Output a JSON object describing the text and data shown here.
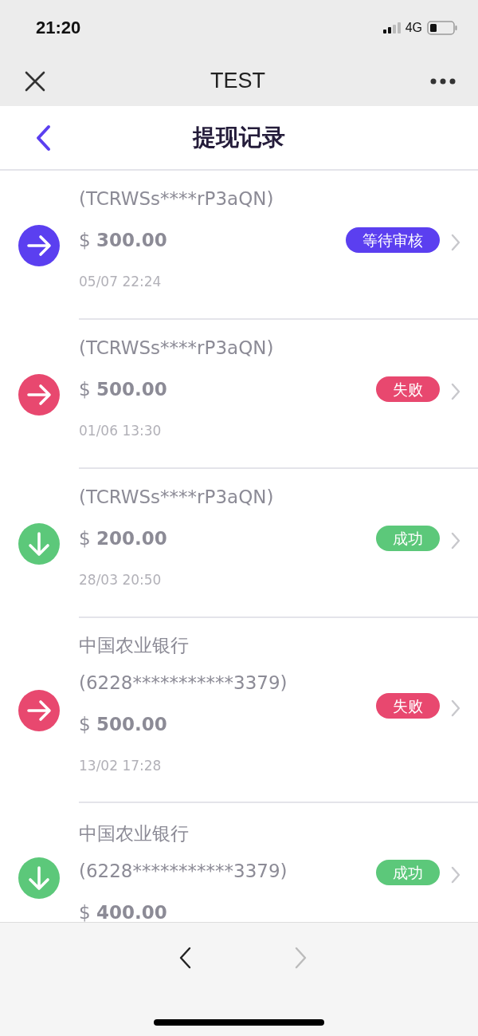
{
  "status_bar": {
    "time": "21:20",
    "network": "4G"
  },
  "browser_bar": {
    "title": "TEST"
  },
  "header": {
    "title": "提现记录"
  },
  "records": [
    {
      "kind": "outgoing",
      "account": "(TCRWSs****rP3aQN)",
      "amount": "$ **300.00**",
      "date": "05/07 22:24",
      "status": {
        "label": "等待审核",
        "color": "#5b3ff0"
      }
    },
    {
      "kind": "outgoing",
      "account": "(TCRWSs****rP3aQN)",
      "amount": "$ **500.00**",
      "date": "01/06 13:30",
      "status": {
        "label": "失败",
        "color": "#e8486f"
      }
    },
    {
      "kind": "incoming",
      "account": "(TCRWSs****rP3aQN)",
      "amount": "$ **200.00**",
      "date": "28/03 20:50",
      "status": {
        "label": "成功",
        "color": "#5cc87a"
      }
    },
    {
      "kind": "outgoing",
      "bank": "中国农业银行",
      "account": "(6228***********3379)",
      "amount": "$ **500.00**",
      "date": "13/02 17:28",
      "status": {
        "label": "失败",
        "color": "#e8486f"
      }
    },
    {
      "kind": "incoming",
      "bank": "中国农业银行",
      "account": "(6228***********3379)",
      "amount": "$ **400.00**",
      "status": {
        "label": "成功",
        "color": "#5cc87a"
      }
    }
  ],
  "bottom_bar": {
    "back_disabled": false,
    "forward_disabled": true
  }
}
